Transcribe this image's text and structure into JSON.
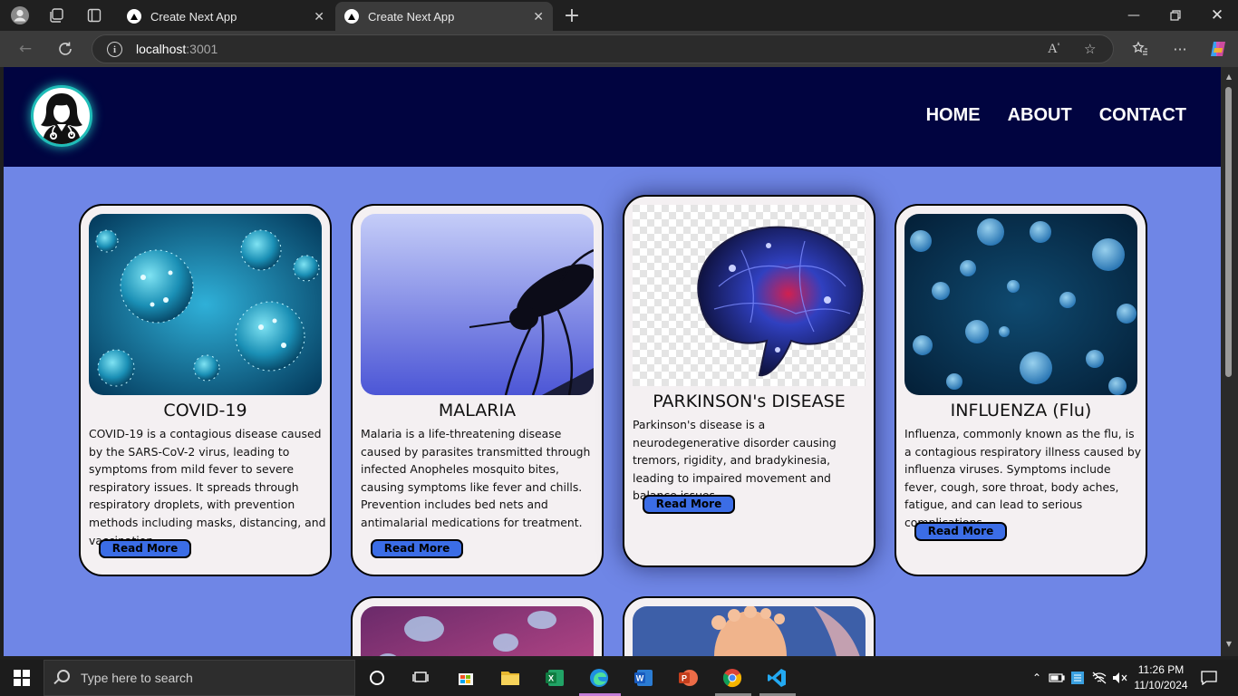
{
  "browser": {
    "tabs": [
      {
        "title": "Create Next App",
        "active": false
      },
      {
        "title": "Create Next App",
        "active": true
      }
    ],
    "address": {
      "host": "localhost",
      "port": ":3001"
    }
  },
  "site": {
    "nav": [
      "HOME",
      "ABOUT",
      "CONTACT"
    ],
    "cards": [
      {
        "title": "COVID-19",
        "description": "COVID-19 is a contagious disease caused by the SARS-CoV-2 virus, leading to symptoms from mild fever to severe respiratory issues. It spreads through respiratory droplets, with prevention methods including masks, distancing, and vaccination.",
        "button": "Read More"
      },
      {
        "title": "MALARIA",
        "description": "Malaria is a life-threatening disease caused by parasites transmitted through infected Anopheles mosquito bites, causing symptoms like fever and chills. Prevention includes bed nets and antimalarial medications for treatment.",
        "button": "Read More"
      },
      {
        "title": "PARKINSON's DISEASE",
        "description": "Parkinson's disease is a neurodegenerative disorder causing tremors, rigidity, and bradykinesia, leading to impaired movement and balance issues.",
        "button": "Read More"
      },
      {
        "title": "INFLUENZA (Flu)",
        "description": "Influenza, commonly known as the flu, is a contagious respiratory illness caused by influenza viruses. Symptoms include fever, cough, sore throat, body aches, fatigue, and can lead to serious complications",
        "button": "Read More"
      }
    ]
  },
  "taskbar": {
    "search_placeholder": "Type here to search",
    "time": "11:26 PM",
    "date": "11/10/2024"
  },
  "colors": {
    "header_bg": "#010440",
    "page_bg": "#6f86e6",
    "card_bg": "#f4f0f2",
    "button_bg": "#3b6de6",
    "logo_ring": "#1fbdb8"
  }
}
